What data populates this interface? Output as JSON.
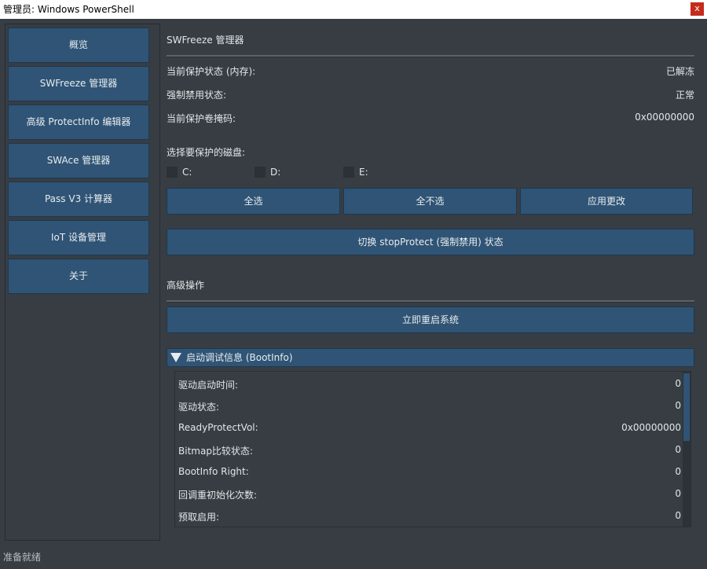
{
  "window": {
    "title": "管理员: Windows PowerShell",
    "close_label": "x"
  },
  "sidebar": {
    "items": [
      {
        "label": "概览"
      },
      {
        "label": "SWFreeze 管理器"
      },
      {
        "label": "高级 ProtectInfo 编辑器"
      },
      {
        "label": "SWAce 管理器"
      },
      {
        "label": "Pass V3 计算器"
      },
      {
        "label": "IoT 设备管理"
      },
      {
        "label": "关于"
      }
    ]
  },
  "main": {
    "title": "SWFreeze 管理器",
    "status_rows": [
      {
        "label": "当前保护状态 (内存):",
        "value": "已解冻"
      },
      {
        "label": "强制禁用状态:",
        "value": "正常"
      },
      {
        "label": "当前保护卷掩码:",
        "value": "0x00000000"
      }
    ],
    "disk_prompt": "选择要保护的磁盘:",
    "disks": [
      {
        "label": "C:"
      },
      {
        "label": "D:"
      },
      {
        "label": "E:"
      }
    ],
    "buttons": {
      "select_all": "全选",
      "select_none": "全不选",
      "apply": "应用更改",
      "toggle_stop": "切换 stopProtect (强制禁用) 状态"
    },
    "advanced_title": "高级操作",
    "reboot_label": "立即重启系统",
    "bootinfo": {
      "header": "启动调试信息 (BootInfo)",
      "rows": [
        {
          "label": "驱动启动时间:",
          "value": "0"
        },
        {
          "label": "驱动状态:",
          "value": "0"
        },
        {
          "label": "ReadyProtectVol:",
          "value": "0x00000000"
        },
        {
          "label": "Bitmap比较状态:",
          "value": "0"
        },
        {
          "label": "BootInfo Right:",
          "value": "0"
        },
        {
          "label": "回调重初始化次数:",
          "value": "0"
        },
        {
          "label": "预取启用:",
          "value": "0"
        }
      ]
    }
  },
  "statusbar": {
    "text": "准备就绪"
  }
}
